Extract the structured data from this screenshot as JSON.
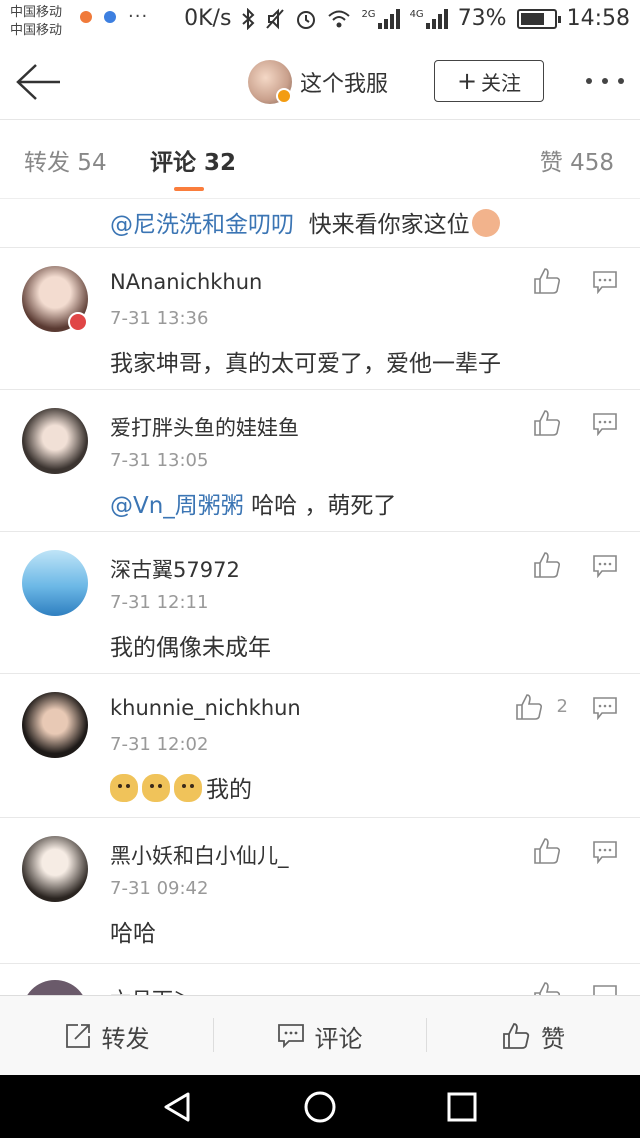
{
  "status_bar": {
    "carrier_1": "中国移动",
    "carrier_2": "中国移动",
    "more": "···",
    "speed": "0K/s",
    "net_2g": "2G",
    "net_4g": "4G",
    "battery": "73%",
    "battery_level": 0.73,
    "time": "14:58"
  },
  "header": {
    "title": "这个我服",
    "follow_label": "关注"
  },
  "tabs": {
    "repost": "转发 54",
    "comment": "评论 32",
    "like": "赞 458"
  },
  "first_line": {
    "mention": "@尼洗洗和金叨叨",
    "text": "快来看你家这位"
  },
  "comments": [
    {
      "name": "NAnanichkhun",
      "time": "7-31 13:36",
      "text": "我家坤哥，真的太可爱了，爱他一辈子",
      "likes": ""
    },
    {
      "name": "爱打胖头鱼的娃娃鱼",
      "time": "7-31 13:05",
      "mention": "@Vn_周粥粥",
      "text": "哈哈 ，萌死了",
      "likes": ""
    },
    {
      "name": "深古翼57972",
      "time": "7-31 12:11",
      "text": "我的偶像未成年",
      "likes": ""
    },
    {
      "name": "khunnie_nichkhun",
      "time": "7-31 12:02",
      "text": "我的",
      "likes": "2"
    },
    {
      "name": "黑小妖和白小仙儿_",
      "time": "7-31 09:42",
      "text": "哈哈",
      "likes": ""
    }
  ],
  "partial_name": "六月下＞",
  "action_bar": {
    "repost": "转发",
    "comment": "评论",
    "like": "赞"
  },
  "colors": {
    "accent": "#fa7d3c",
    "mention": "#3b75b4",
    "text": "#333333",
    "muted": "#999999"
  }
}
